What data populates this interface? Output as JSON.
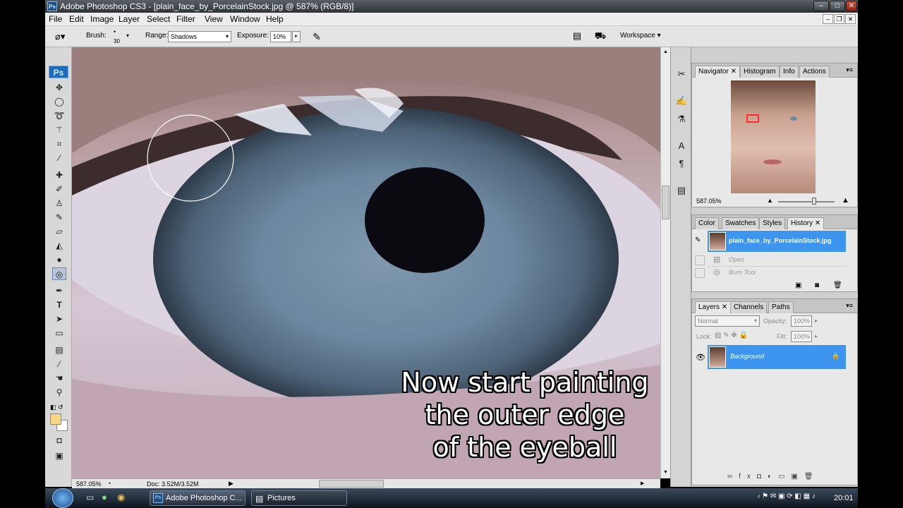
{
  "window": {
    "title": "Adobe Photoshop CS3 - [plain_face_by_PorcelainStock.jpg @ 587% (RGB/8)]",
    "app_badge": "Ps"
  },
  "menu": [
    "File",
    "Edit",
    "Image",
    "Layer",
    "Select",
    "Filter",
    "View",
    "Window",
    "Help"
  ],
  "options_bar": {
    "brush_label": "Brush:",
    "brush_size": "30",
    "range_label": "Range:",
    "range_value": "Shadows",
    "exposure_label": "Exposure:",
    "exposure_value": "10%",
    "workspace_label": "Workspace"
  },
  "toolbox": {
    "ps_logo": "Ps",
    "tools": [
      "move-icon",
      "marquee-icon",
      "lasso-icon",
      "magic-wand-icon",
      "crop-icon",
      "eyedropper-icon",
      "healing-icon",
      "brush-icon",
      "clone-stamp-icon",
      "history-brush-icon",
      "eraser-icon",
      "paint-bucket-icon",
      "blur-icon",
      "burn-icon",
      "pen-icon",
      "type-icon",
      "path-selection-icon",
      "shape-icon",
      "notes-icon",
      "eyedropper2-icon",
      "hand-icon",
      "zoom-icon"
    ]
  },
  "caption": {
    "line1": "Now start painting",
    "line2": "the outer edge",
    "line3": "of the eyeball"
  },
  "status": {
    "zoom": "587.05%",
    "doc": "Doc: 3.52M/3.52M"
  },
  "navigator_panel": {
    "tabs": [
      "Navigator",
      "Histogram",
      "Info",
      "Actions"
    ],
    "zoom": "587.05%"
  },
  "history_panel": {
    "tabs": [
      "Color",
      "Swatches",
      "Styles",
      "History"
    ],
    "snapshot": "plain_face_by_PorcelainStock.jpg",
    "states": [
      "Open",
      "Burn Tool"
    ]
  },
  "layers_panel": {
    "tabs": [
      "Layers",
      "Channels",
      "Paths"
    ],
    "blend_mode": "Normal",
    "opacity_label": "Opacity:",
    "opacity_value": "100%",
    "lock_label": "Lock:",
    "fill_label": "Fill:",
    "fill_value": "100%",
    "layer_name": "Background"
  },
  "taskbar": {
    "tasks": [
      "Adobe Photoshop C...",
      "Pictures"
    ],
    "clock": "20:01"
  },
  "colors": {
    "selection_blue": "#3d95f0",
    "titlebar": "#3a3f45"
  }
}
